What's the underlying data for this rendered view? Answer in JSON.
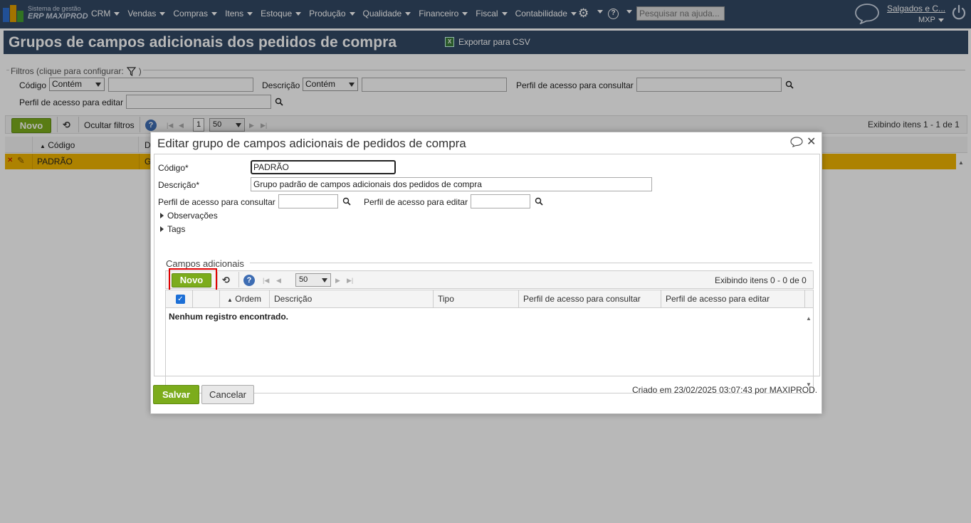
{
  "topbar": {
    "brand_small": "Sistema de gestão",
    "brand_big": "ERP MAXIPROD",
    "menu": [
      "CRM",
      "Vendas",
      "Compras",
      "Itens",
      "Estoque",
      "Produção",
      "Qualidade",
      "Financeiro",
      "Fiscal",
      "Contabilidade"
    ],
    "help_search_placeholder": "Pesquisar na ajuda...",
    "company": "Salgados e C...",
    "user": "MXP",
    "colors": {
      "bar": "#334864",
      "accent_green": "#7cac1c",
      "selected_row": "#f0b400"
    }
  },
  "page": {
    "title": "Grupos de campos adicionais dos pedidos de compra",
    "export_label": "Exportar para CSV"
  },
  "filters": {
    "legend": "Filtros (clique para configurar:",
    "legend_end": ")",
    "codigo_label": "Código",
    "codigo_operator": "Contém",
    "descricao_label": "Descrição",
    "descricao_operator": "Contém",
    "perfil_consultar_label": "Perfil de acesso para consultar",
    "perfil_editar_label": "Perfil de acesso para editar"
  },
  "list_toolbar": {
    "novo": "Novo",
    "ocultar_filtros": "Ocultar filtros",
    "page": "1",
    "per_page": "50",
    "exibindo": "Exibindo itens 1 - 1 de 1"
  },
  "list": {
    "col_codigo": "Código",
    "col_desc_initial": "D",
    "row": {
      "codigo": "PADRÃO",
      "desc_initial": "G"
    }
  },
  "dialog": {
    "title": "Editar grupo de campos adicionais de pedidos de compra",
    "codigo_label": "Código*",
    "codigo_value": "PADRÃO",
    "descricao_label": "Descrição*",
    "descricao_value": "Grupo padrão de campos adicionais dos pedidos de compra",
    "perfil_consultar_label": "Perfil de acesso para consultar",
    "perfil_editar_label": "Perfil de acesso para editar",
    "observacoes": "Observações",
    "tags": "Tags",
    "section_title": "Campos adicionais",
    "inner_toolbar": {
      "novo": "Novo",
      "per_page": "50",
      "exibindo": "Exibindo itens 0 - 0 de 0"
    },
    "grid_columns": [
      "Ordem",
      "Descrição",
      "Tipo",
      "Perfil de acesso para consultar",
      "Perfil de acesso para editar"
    ],
    "empty_message": "Nenhum registro encontrado.",
    "salvar": "Salvar",
    "cancelar": "Cancelar",
    "created": "Criado em 23/02/2025 03:07:43 por MAXIPROD."
  }
}
